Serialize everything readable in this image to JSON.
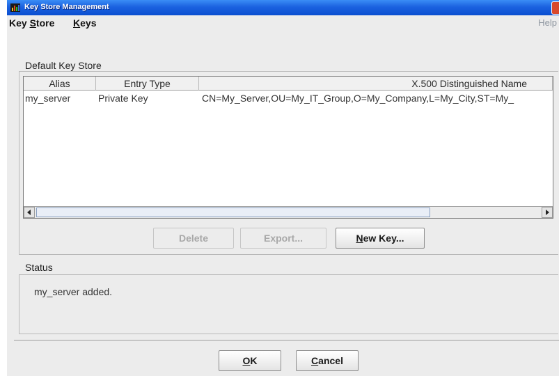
{
  "window": {
    "title": "Key Store Management"
  },
  "menubar": {
    "items": [
      "Key Store",
      "Keys"
    ],
    "help": "Help"
  },
  "keystore_group": {
    "title": "Default Key Store"
  },
  "table": {
    "columns": [
      "Alias",
      "Entry Type",
      "X.500 Distinguished Name"
    ],
    "rows": [
      [
        "my_server",
        "Private Key",
        "CN=My_Server,OU=My_IT_Group,O=My_Company,L=My_City,ST=My_"
      ]
    ]
  },
  "actions": {
    "delete": "Delete",
    "export": "Export...",
    "new_key": "New Key..."
  },
  "status_group": {
    "title": "Status",
    "message": "my_server added."
  },
  "dialog_buttons": {
    "ok": "OK",
    "cancel": "Cancel"
  },
  "icons": {
    "app": "key-store-app-icon",
    "close": "close-icon",
    "scroll_left": "scroll-left-arrow-icon",
    "scroll_right": "scroll-right-arrow-icon"
  },
  "colors": {
    "titlebar": "#1b62e0",
    "close": "#d9492b",
    "window_bg": "#ececec"
  }
}
